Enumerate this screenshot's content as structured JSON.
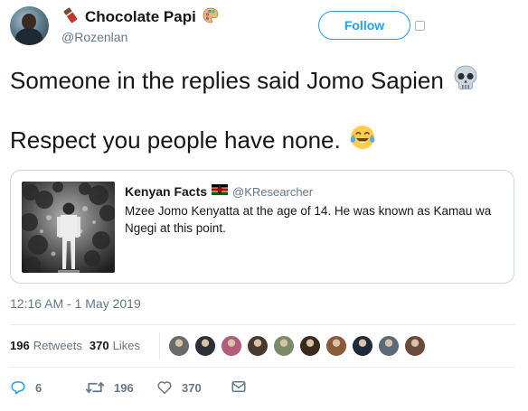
{
  "author": {
    "display_name": "Chocolate Papi",
    "handle": "@Rozenlan",
    "name_emojis": [
      "chocolate-bar-icon",
      "palette-icon"
    ]
  },
  "follow_button": {
    "label": "Follow"
  },
  "tweet": {
    "line1": "Someone in the replies said Jomo Sapien",
    "line1_emoji": "skull-icon",
    "line2": "Respect you people have none.",
    "line2_emoji": "tears-of-joy-icon"
  },
  "quoted": {
    "display_name": "Kenyan Facts",
    "flag": "kenya-flag-icon",
    "handle": "@KResearcher",
    "text": "Mzee Jomo Kenyatta at the age of 14. He was known as Kamau wa Ngegi at this point."
  },
  "timestamp": "12:16 AM - 1 May 2019",
  "stats": {
    "retweets_count": "196",
    "retweets_label": "Retweets",
    "likes_count": "370",
    "likes_label": "Likes"
  },
  "liker_colors": [
    "#6b6b6b",
    "#2a2f3a",
    "#b45a7a",
    "#4a3a2e",
    "#7a8a6a",
    "#3a2a1e",
    "#8a5a3a",
    "#1e2a3a",
    "#5a6a7a",
    "#6a4a3a"
  ],
  "actions": {
    "reply_count": "6",
    "retweet_count": "196",
    "like_count": "370"
  },
  "colors": {
    "accent": "#1da1f2",
    "muted": "#657786",
    "text": "#14171a",
    "border": "#e6ecf0"
  }
}
